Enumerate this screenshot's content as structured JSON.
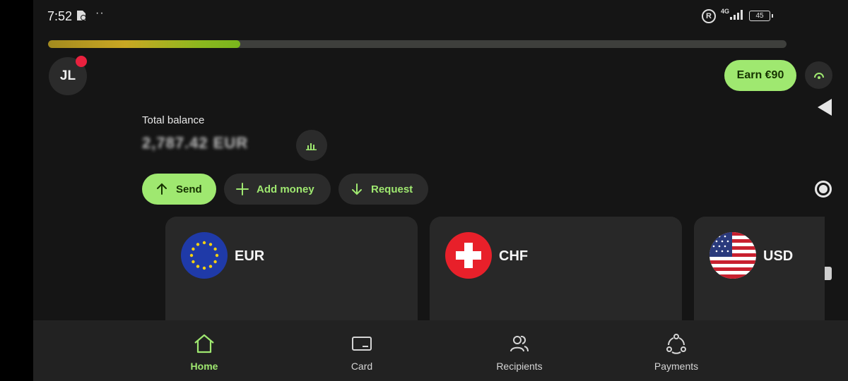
{
  "status_bar": {
    "time": "7:52",
    "dots": "··",
    "network": "4G",
    "battery": "45"
  },
  "progress": {
    "fraction": 0.26
  },
  "header": {
    "avatar_initials": "JL",
    "earn_label": "Earn €90"
  },
  "balance": {
    "label": "Total balance",
    "value": "2,787.42 EUR"
  },
  "actions": {
    "send": "Send",
    "add_money": "Add money",
    "request": "Request"
  },
  "accounts": [
    {
      "currency": "EUR",
      "flag": "eu-flag"
    },
    {
      "currency": "CHF",
      "flag": "swiss-flag"
    },
    {
      "currency": "USD",
      "flag": "us-flag"
    }
  ],
  "nav": [
    {
      "label": "Home",
      "icon": "home-icon",
      "active": true
    },
    {
      "label": "Card",
      "icon": "card-icon",
      "active": false
    },
    {
      "label": "Recipients",
      "icon": "recipients-icon",
      "active": false
    },
    {
      "label": "Payments",
      "icon": "payments-icon",
      "active": false
    }
  ],
  "colors": {
    "accent": "#9fe870",
    "background": "#151515",
    "surface": "#282828",
    "notification": "#e9213e"
  }
}
